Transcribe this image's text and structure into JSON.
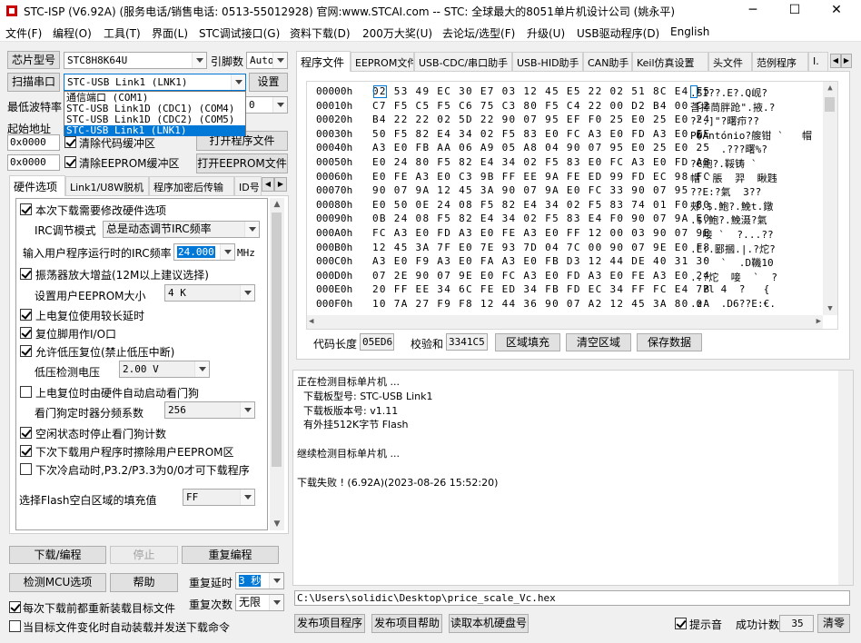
{
  "window": {
    "title": "STC-ISP (V6.92A) (服务电话/销售电话: 0513-55012928) 官网:www.STCAI.com  -- STC: 全球最大的8051单片机设计公司 (姚永平)",
    "minimize": "─",
    "maximize": "☐",
    "close": "✕"
  },
  "menu": [
    "文件(F)",
    "编程(O)",
    "工具(T)",
    "界面(L)",
    "STC调试接口(G)",
    "资料下载(D)",
    "200万大奖(U)",
    "去论坛/选型(F)",
    "升级(U)",
    "USB驱动程序(D)",
    "English"
  ],
  "left": {
    "chip_label": "芯片型号",
    "chip_value": "STC8H8K64U",
    "pin_label": "引脚数",
    "pin_value": "Auto",
    "scan_button": "扫描串口",
    "port_value": "STC-USB Link1 (LNK1)",
    "settings_button": "设置",
    "baud_label": "最低波特率",
    "baud_value": "0",
    "start_label": "起始地址",
    "addr1": "0x0000",
    "clear_code": "清除代码缓冲区",
    "open_program": "打开程序文件",
    "addr2": "0x0000",
    "clear_eeprom": "清除EEPROM缓冲区",
    "open_eeprom": "打开EEPROM文件",
    "port_options": [
      "通信端口 (COM1)",
      "STC-USB Link1D (CDC1) (COM4)",
      "STC-USB Link1D (CDC2) (COM5)",
      "STC-USB Link1 (LNK1)"
    ]
  },
  "hwtabs": [
    "硬件选项",
    "Link1/U8W脱机",
    "程序加密后传输",
    "ID号"
  ],
  "hw": {
    "opt1": "本次下载需要修改硬件选项",
    "irc_mode_label": "IRC调节模式",
    "irc_mode_value": "总是动态调节IRC频率",
    "irc_freq_label": "输入用户程序运行时的IRC频率",
    "irc_freq_value": "24.000",
    "irc_unit": "MHz",
    "opt2": "振荡器放大增益(12M以上建议选择)",
    "eeprom_size_label": "设置用户EEPROM大小",
    "eeprom_size_value": "4   K",
    "opt3": "上电复位使用较长延时",
    "opt4": "复位脚用作I/O口",
    "opt5": "允许低压复位(禁止低压中断)",
    "lvd_label": "低压检测电压",
    "lvd_value": "2.00 V",
    "opt6": "上电复位时由硬件自动启动看门狗",
    "wdt_label": "看门狗定时器分频系数",
    "wdt_value": "256",
    "opt7": "空闲状态时停止看门狗计数",
    "opt8": "下次下载用户程序时擦除用户EEPROM区",
    "opt9": "下次冷启动时,P3.2/P3.3为0/0才可下载程序",
    "fill_label": "选择Flash空白区域的填充值",
    "fill_value": "FF"
  },
  "bottom": {
    "download": "下载/编程",
    "stop": "停止",
    "reprogram": "重复编程",
    "detect": "检测MCU选项",
    "help": "帮助",
    "delay_label": "重复延时",
    "delay_value": "3 秒",
    "count_label": "重复次数",
    "count_value": "无限",
    "reload": "每次下载前都重新装载目标文件",
    "auto_send": "当目标文件变化时自动装载并发送下载命令"
  },
  "righttabs": [
    "程序文件",
    "EEPROM文件",
    "USB-CDC/串口助手",
    "USB-HID助手",
    "CAN助手",
    "Keil仿真设置",
    "头文件",
    "范例程序",
    "I."
  ],
  "hex": {
    "rows": [
      {
        "addr": "00000h",
        "bytes": "02 53 49 EC 30 E7 03 12 45 E5 22 02 51 8C E4 F5",
        "ascii": ".SI??.E?.Q岘?"
      },
      {
        "addr": "00010h",
        "bytes": "C7 F5 C5 F5 C6 75 C3 80 F5 C4 22 00 D2 B4 00 C2",
        "ascii": "莟捧茼胖跄\".掖.?"
      },
      {
        "addr": "00020h",
        "bytes": "B4 22 22 02 5D 22 90 07 95 EF F0 25 E0 25 E0 24",
        "ascii": "?\".]\"?曙疖??"
      },
      {
        "addr": "00030h",
        "bytes": "50 F5 82 E4 34 02 F5 83 E0 FC A3 E0 FD A3 E0 FE",
        "ascii": "P�António?艘钳 `   帽"
      },
      {
        "addr": "00040h",
        "bytes": "A3 E0 FB AA 06 A9 05 A8 04 90 07 95 E0 25 E0 25",
        "ascii": "  `  .???曙%?"
      },
      {
        "addr": "00050h",
        "bytes": "E0 24 80 F5 82 E4 34 02 F5 83 E0 FC A3 E0 FD A3",
        "ascii": "?€鮑?.鞖铸 `"
      },
      {
        "addr": "00060h",
        "bytes": "E0 FE A3 E0 C3 9B FF EE 9A FE ED 99 FD EC 98 FC",
        "ascii": "帽 `脹  羿  瞅韪"
      },
      {
        "addr": "00070h",
        "bytes": "90 07 9A 12 45 3A 90 07 9A E0 FC 33 90 07 95",
        "ascii": "??E:?氣  3??"
      },
      {
        "addr": "00080h",
        "bytes": "E0 50 0E 24 08 F5 82 E4 34 02 F5 83 74 01 F0 80",
        "ascii": "郟.$.鮑?.鮸t.鐓"
      },
      {
        "addr": "00090h",
        "bytes": "0B 24 08 F5 82 E4 34 02 F5 83 E4 F0 90 07 9A E0",
        "ascii": ".$.鮑?.鮸滠?氣"
      },
      {
        "addr": "000A0h",
        "bytes": "FC A3 E0 FD A3 E0 FE A3 E0 FF 12 00 03 90 07 9E",
        "ascii": "  唼 `  ?...??"
      },
      {
        "addr": "000B0h",
        "bytes": "12 45 3A 7F E0 7E 93 7D 04 7C 00 90 07 9E E0 F8",
        "ascii": ".E:.郾摑.|.?炨?"
      },
      {
        "addr": "000C0h",
        "bytes": "A3 E0 F9 A3 E0 FA A3 E0 FB D3 12 44 DE 40 31 30",
        "ascii": "  `  `  .D鞿10"
      },
      {
        "addr": "000D0h",
        "bytes": "07 2E 90 07 9E E0 FC A3 E0 FD A3 E0 FE A3 E0 24",
        "ascii": "..?炨  唼  `  ?"
      },
      {
        "addr": "000E0h",
        "bytes": "20 FF EE 34 6C FE ED 34 FB FD EC 34 FF FC E4 7B",
        "ascii": "  ?l 4  ?   {"
      },
      {
        "addr": "000F0h",
        "bytes": "10 7A 27 F9 F8 12 44 36 90 07 A2 12 45 3A 80 0A",
        "ascii": ".z'  .D6??E:€."
      }
    ],
    "code_len_label": "代码长度",
    "code_len": "05ED6",
    "checksum_label": "校验和",
    "checksum": "3341C5",
    "fill_btn": "区域填充",
    "clear_btn": "清空区域",
    "save_btn": "保存数据"
  },
  "log": [
    "正在检测目标单片机 ...",
    "  下载板型号: STC-USB Link1",
    "  下载板版本号: v1.11",
    "  有外挂512K字节 Flash",
    "",
    "继续检测目标单片机 ...",
    "",
    "下载失败 ! (6.92A)(2023-08-26 15:52:20)"
  ],
  "path": "C:\\Users\\solidic\\Desktop\\price_scale_Vc.hex",
  "footer": {
    "publish": "发布项目程序",
    "publish_help": "发布项目帮助",
    "read_disk": "读取本机硬盘号",
    "beep": "提示音",
    "success_label": "成功计数",
    "success_value": "35",
    "clear": "清零"
  }
}
